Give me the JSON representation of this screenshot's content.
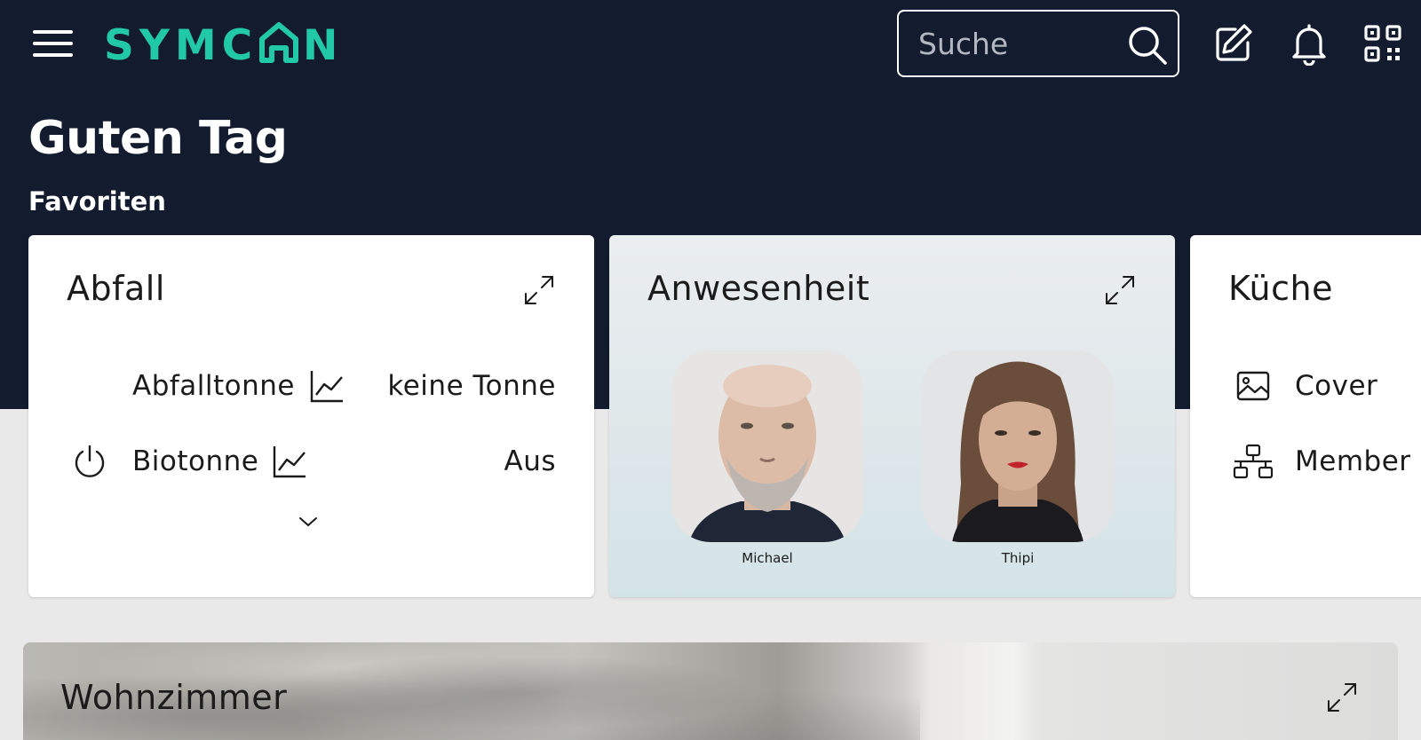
{
  "header": {
    "logo_text": "SYMCON",
    "search_placeholder": "Suche"
  },
  "greeting": "Guten Tag",
  "favorites_label": "Favoriten",
  "cards": {
    "abfall": {
      "title": "Abfall",
      "rows": [
        {
          "label": "Abfalltonne",
          "value": "keine Tonne"
        },
        {
          "label": "Biotonne",
          "value": "Aus"
        }
      ]
    },
    "anwesenheit": {
      "title": "Anwesenheit",
      "people": [
        {
          "name": "Michael"
        },
        {
          "name": "Thipi"
        }
      ]
    },
    "kueche": {
      "title": "Küche",
      "rows": [
        {
          "label": "Cover"
        },
        {
          "label": "Member o"
        }
      ]
    },
    "wohnzimmer": {
      "title": "Wohnzimmer"
    }
  },
  "colors": {
    "header_bg": "#131c2e",
    "brand_accent": "#21c9a8",
    "page_bg": "#e9e9e9"
  }
}
